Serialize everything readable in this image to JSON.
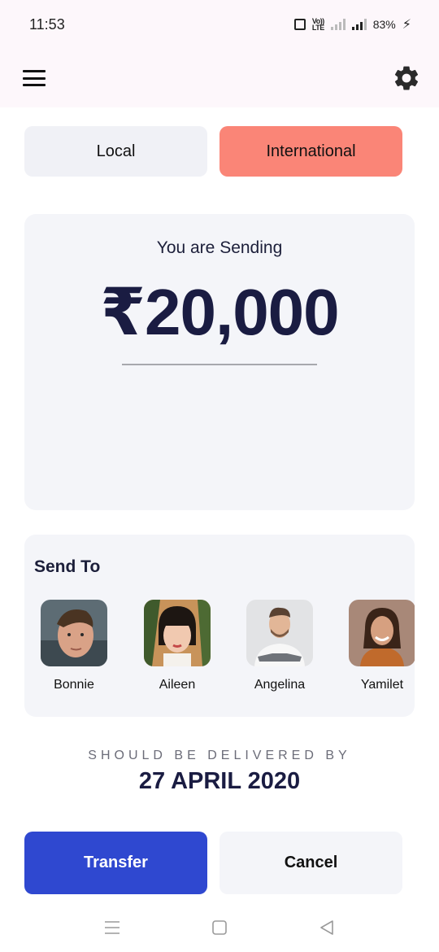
{
  "status": {
    "time": "11:53",
    "volte_top": "Vo))",
    "volte_bottom": "LTE",
    "battery": "83%",
    "charging_glyph": "⚡"
  },
  "appbar": {
    "menu_icon": "hamburger-menu-icon",
    "settings_icon": "gear-icon"
  },
  "tabs": {
    "local": "Local",
    "international": "International",
    "selected": "International",
    "selected_color": "#fa8577"
  },
  "sending": {
    "label": "You are Sending",
    "amount": "₹20,000"
  },
  "send_to": {
    "title": "Send To",
    "contacts": [
      {
        "name": "Bonnie"
      },
      {
        "name": "Aileen"
      },
      {
        "name": "Angelina"
      },
      {
        "name": "Yamilet"
      }
    ]
  },
  "delivery": {
    "label": "SHOULD BE DELIVERED BY",
    "date": "27 APRIL 2020"
  },
  "actions": {
    "transfer": "Transfer",
    "cancel": "Cancel",
    "transfer_color": "#2f48d0"
  },
  "navbar": {
    "icons": [
      "recents-icon",
      "home-icon",
      "back-icon"
    ]
  }
}
